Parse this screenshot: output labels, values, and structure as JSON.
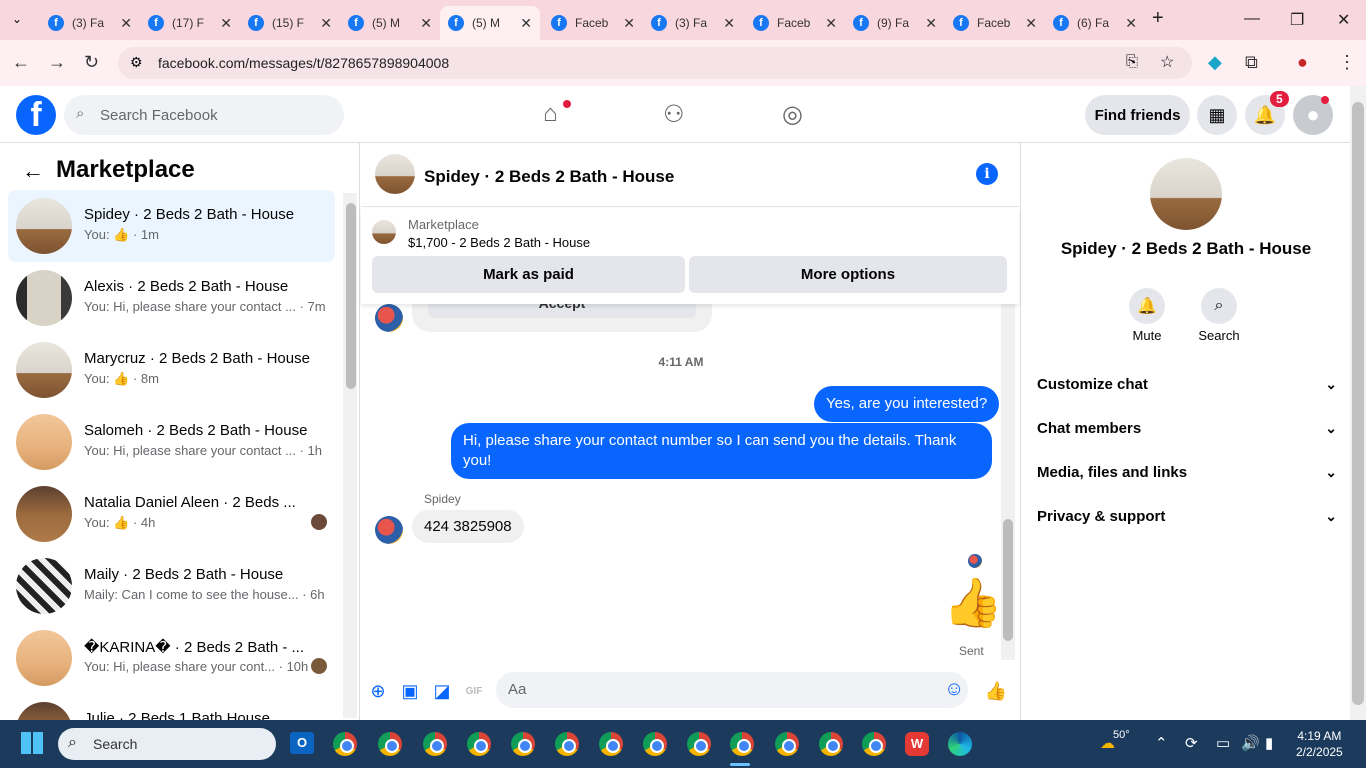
{
  "browser": {
    "tabs": [
      {
        "label": "(3) Fa",
        "badge": "f"
      },
      {
        "label": "(17) F",
        "badge": "f"
      },
      {
        "label": "(15) F",
        "badge": "f"
      },
      {
        "label": "(5) M",
        "badge": "f"
      },
      {
        "label": "(5) M",
        "badge": "f",
        "active": true
      },
      {
        "label": "Faceb",
        "badge": "f"
      },
      {
        "label": "(3) Fa",
        "badge": "f"
      },
      {
        "label": "Faceb",
        "badge": "f"
      },
      {
        "label": "(9) Fa",
        "badge": "f"
      },
      {
        "label": "Faceb",
        "badge": "f"
      },
      {
        "label": "(6) Fa",
        "badge": "f"
      }
    ],
    "url": "facebook.com/messages/t/8278657898904008"
  },
  "fb_header": {
    "search_placeholder": "Search Facebook",
    "find_friends": "Find friends",
    "notifications_count": "5"
  },
  "left_panel": {
    "title": "Marketplace",
    "conversations": [
      {
        "name": "Spidey · 2 Beds 2 Bath - House",
        "preview": "You: 👍 · 1m"
      },
      {
        "name": "Alexis · 2 Beds 2 Bath - House",
        "preview": "You: Hi, please share your contact ... · 7m"
      },
      {
        "name": "Marycruz · 2 Beds 2 Bath - House",
        "preview": "You: 👍 · 8m"
      },
      {
        "name": "Salomeh · 2 Beds 2 Bath - House",
        "preview": "You: Hi, please share your contact ... · 1h"
      },
      {
        "name": "Natalia Daniel Aleen · 2 Beds ...",
        "preview": "You: 👍 · 4h"
      },
      {
        "name": "Maily · 2 Beds 2 Bath - House",
        "preview": "Maily: Can I come to see the house... · 6h"
      },
      {
        "name": "�KARINA� · 2 Beds 2 Bath - ...",
        "preview": "You: Hi, please share your cont... · 10h"
      },
      {
        "name": "Julie · 2 Beds 1 Bath House",
        "preview": ""
      }
    ]
  },
  "chat": {
    "title": "Spidey · 2 Beds 2 Bath - House",
    "marketplace_label": "Marketplace",
    "listing": "$1,700 - 2 Beds 2 Bath - House",
    "mark_paid": "Mark as paid",
    "more_options": "More options",
    "partial_button": "Accept",
    "timestamp": "4:11 AM",
    "out_msg1": "Yes, are you interested?",
    "out_msg2": "Hi, please share your contact number so I can send you the details. Thank you!",
    "sender_name": "Spidey",
    "in_msg": "424 3825908",
    "status": "Sent",
    "input_placeholder": "Aa"
  },
  "right_panel": {
    "name": "Spidey · 2 Beds 2 Bath - House",
    "mute": "Mute",
    "search": "Search",
    "sections": [
      "Customize chat",
      "Chat members",
      "Media, files and links",
      "Privacy & support"
    ]
  },
  "taskbar": {
    "search_placeholder": "Search",
    "weather": "50°",
    "time": "4:19 AM",
    "date": "2/2/2025"
  }
}
